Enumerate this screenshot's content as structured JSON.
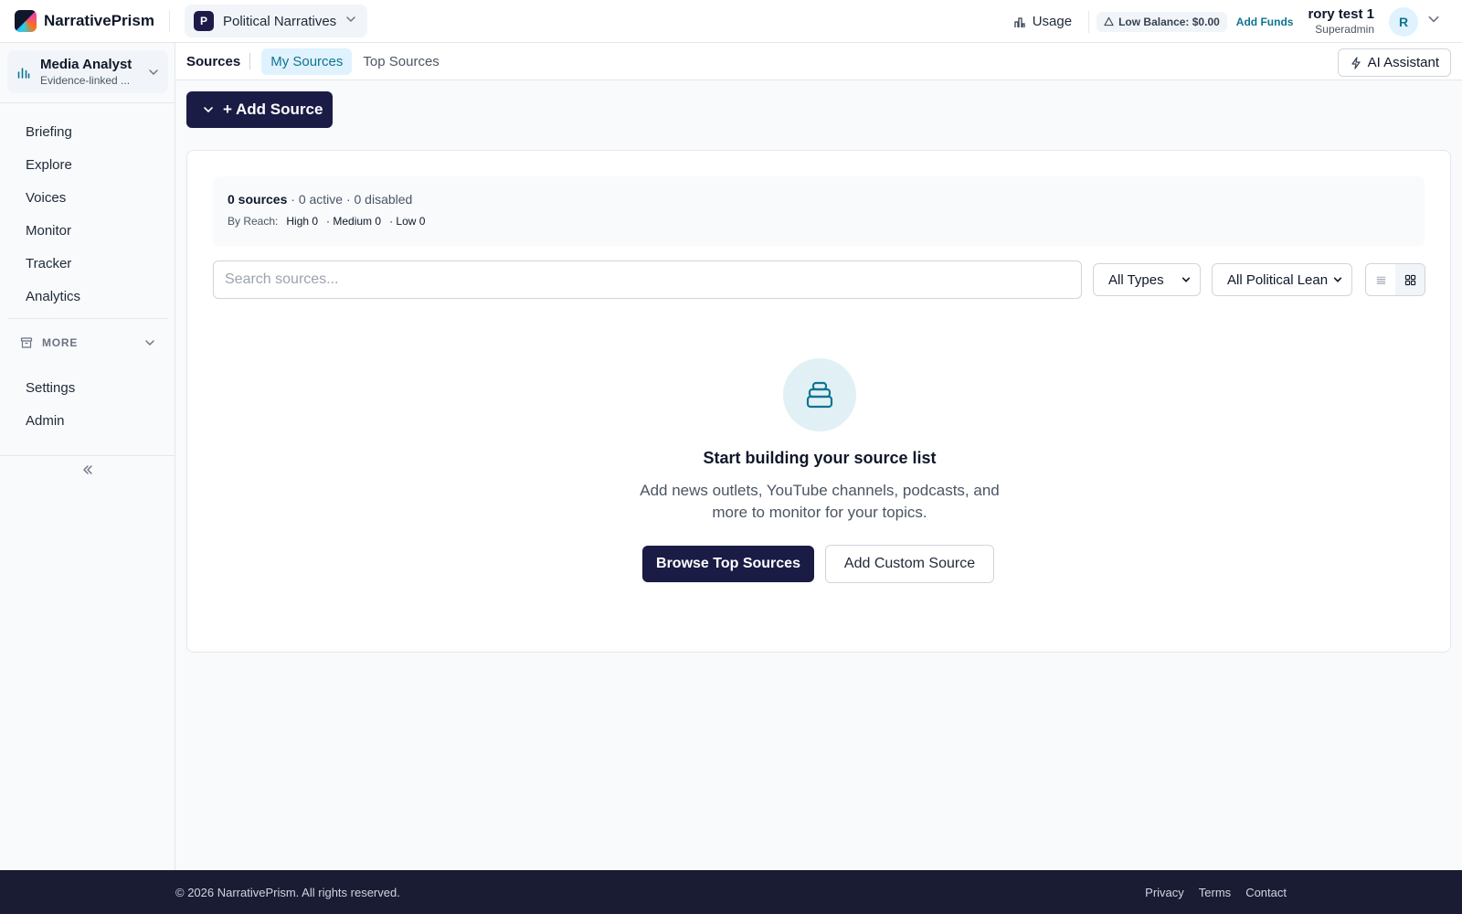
{
  "app": {
    "name": "NarrativePrism",
    "workspace_initial": "P",
    "workspace_name": "Political Narratives"
  },
  "header": {
    "usage_label": "Usage",
    "balance_label": "Low Balance: $0.00",
    "add_funds_label": "Add Funds",
    "user_name": "rory test 1",
    "user_role": "Superadmin",
    "avatar_initial": "R"
  },
  "sidebar": {
    "role_title": "Media Analyst",
    "role_subtitle": "Evidence-linked ...",
    "items": [
      {
        "label": "Briefing"
      },
      {
        "label": "Explore"
      },
      {
        "label": "Voices"
      },
      {
        "label": "Monitor"
      },
      {
        "label": "Tracker"
      },
      {
        "label": "Analytics"
      }
    ],
    "more_label": "MORE",
    "bottom_items": [
      {
        "label": "Settings"
      },
      {
        "label": "Admin"
      }
    ]
  },
  "subheader": {
    "title": "Sources",
    "tabs": [
      {
        "label": "My Sources",
        "active": true
      },
      {
        "label": "Top Sources",
        "active": false
      }
    ],
    "ai_assistant_label": "AI Assistant"
  },
  "main": {
    "add_source_label": "+ Add Source",
    "stats": {
      "sources_count": "0 sources",
      "status_summary": " · 0 active · 0 disabled",
      "reach_label": "By Reach:",
      "high": "High 0",
      "medium": "· Medium 0",
      "low": "· Low 0"
    },
    "search_placeholder": "Search sources...",
    "type_filter": "All Types",
    "lean_filter": "All Political Lean",
    "empty_state": {
      "title": "Start building your source list",
      "description": "Add news outlets, YouTube channels, podcasts, and more to monitor for your topics.",
      "primary_label": "Browse Top Sources",
      "secondary_label": "Add Custom Source"
    }
  },
  "footer": {
    "copyright": "© 2026 NarrativePrism. All rights reserved.",
    "links": [
      {
        "label": "Privacy"
      },
      {
        "label": "Terms"
      },
      {
        "label": "Contact"
      }
    ]
  },
  "colors": {
    "primary_navy": "#1a1c45",
    "accent_teal": "#0e7490",
    "footer_bg": "#1a1c33"
  }
}
